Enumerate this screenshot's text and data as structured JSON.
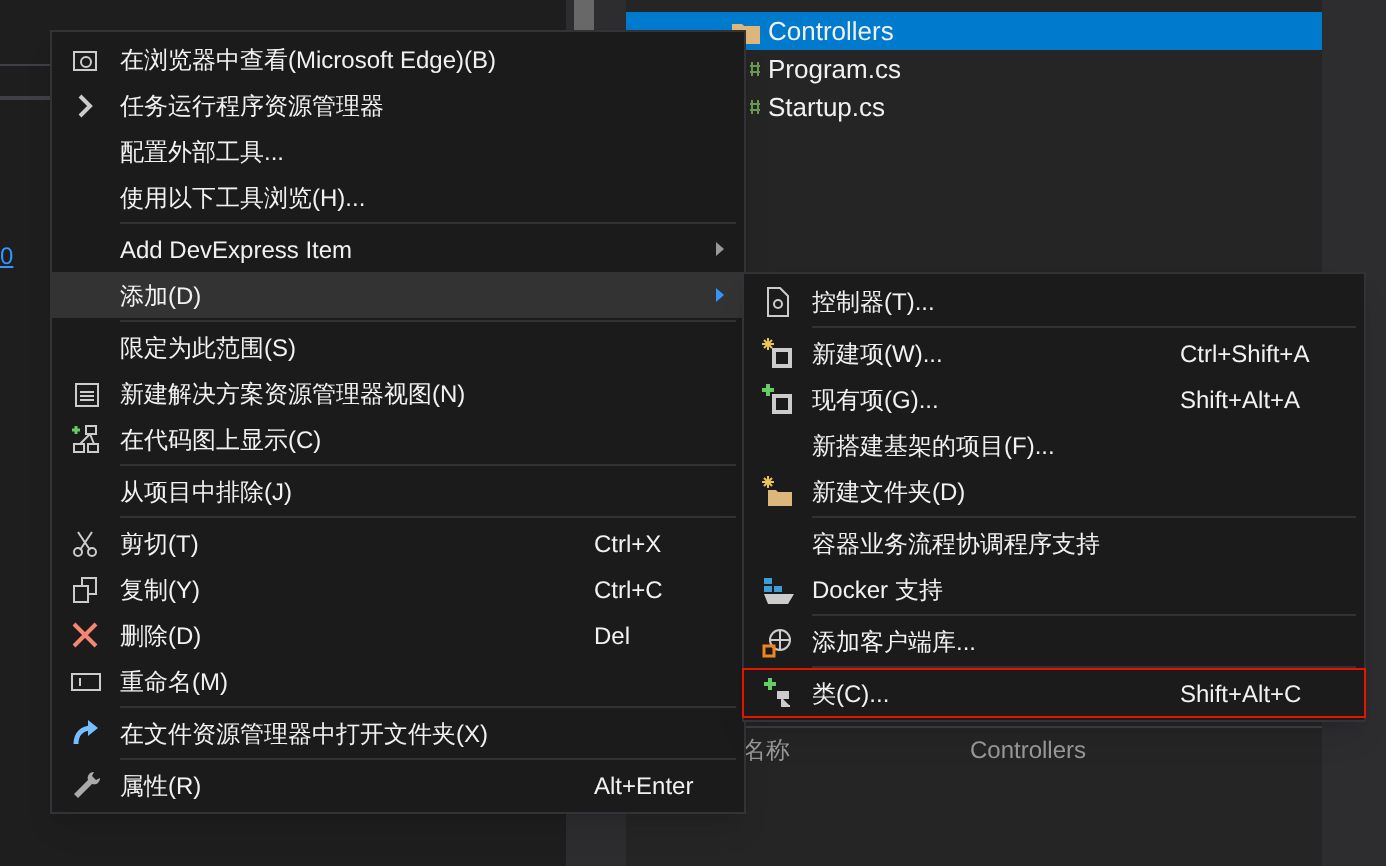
{
  "left_panel": {
    "link": "0"
  },
  "solution_explorer": {
    "items": [
      {
        "label": "Controllers",
        "selected": true,
        "kind": "folder"
      },
      {
        "label": "Program.cs",
        "selected": false,
        "kind": "file"
      },
      {
        "label": "Startup.cs",
        "selected": false,
        "kind": "file"
      }
    ]
  },
  "properties": {
    "name_label": "名称",
    "name_value": "Controllers"
  },
  "context_menu": {
    "items": [
      {
        "kind": "item",
        "label": "在浏览器中查看(Microsoft Edge)(B)"
      },
      {
        "kind": "item",
        "label": "任务运行程序资源管理器"
      },
      {
        "kind": "item",
        "label": "配置外部工具..."
      },
      {
        "kind": "item",
        "label": "使用以下工具浏览(H)..."
      },
      {
        "kind": "separator"
      },
      {
        "kind": "item",
        "label": "Add DevExpress Item",
        "has_submenu": true,
        "selected": false
      },
      {
        "kind": "item",
        "label": "添加(D)",
        "has_submenu": true,
        "selected": true
      },
      {
        "kind": "separator"
      },
      {
        "kind": "item",
        "label": "限定为此范围(S)"
      },
      {
        "kind": "item",
        "label": "新建解决方案资源管理器视图(N)"
      },
      {
        "kind": "item",
        "label": "在代码图上显示(C)"
      },
      {
        "kind": "separator"
      },
      {
        "kind": "item",
        "label": "从项目中排除(J)"
      },
      {
        "kind": "separator"
      },
      {
        "kind": "item",
        "label": "剪切(T)",
        "shortcut": "Ctrl+X"
      },
      {
        "kind": "item",
        "label": "复制(Y)",
        "shortcut": "Ctrl+C"
      },
      {
        "kind": "item",
        "label": "删除(D)",
        "shortcut": "Del"
      },
      {
        "kind": "item",
        "label": "重命名(M)"
      },
      {
        "kind": "separator"
      },
      {
        "kind": "item",
        "label": "在文件资源管理器中打开文件夹(X)"
      },
      {
        "kind": "separator"
      },
      {
        "kind": "item",
        "label": "属性(R)",
        "shortcut": "Alt+Enter"
      }
    ]
  },
  "submenu": {
    "items": [
      {
        "kind": "item",
        "label": "控制器(T)..."
      },
      {
        "kind": "separator"
      },
      {
        "kind": "item",
        "label": "新建项(W)...",
        "shortcut": "Ctrl+Shift+A"
      },
      {
        "kind": "item",
        "label": "现有项(G)...",
        "shortcut": "Shift+Alt+A"
      },
      {
        "kind": "item",
        "label": "新搭建基架的项目(F)..."
      },
      {
        "kind": "item",
        "label": "新建文件夹(D)"
      },
      {
        "kind": "separator"
      },
      {
        "kind": "item",
        "label": "容器业务流程协调程序支持"
      },
      {
        "kind": "item",
        "label": "Docker 支持"
      },
      {
        "kind": "separator"
      },
      {
        "kind": "item",
        "label": "添加客户端库..."
      },
      {
        "kind": "separator"
      },
      {
        "kind": "item",
        "label": "类(C)...",
        "shortcut": "Shift+Alt+C",
        "highlighted": true
      }
    ]
  }
}
